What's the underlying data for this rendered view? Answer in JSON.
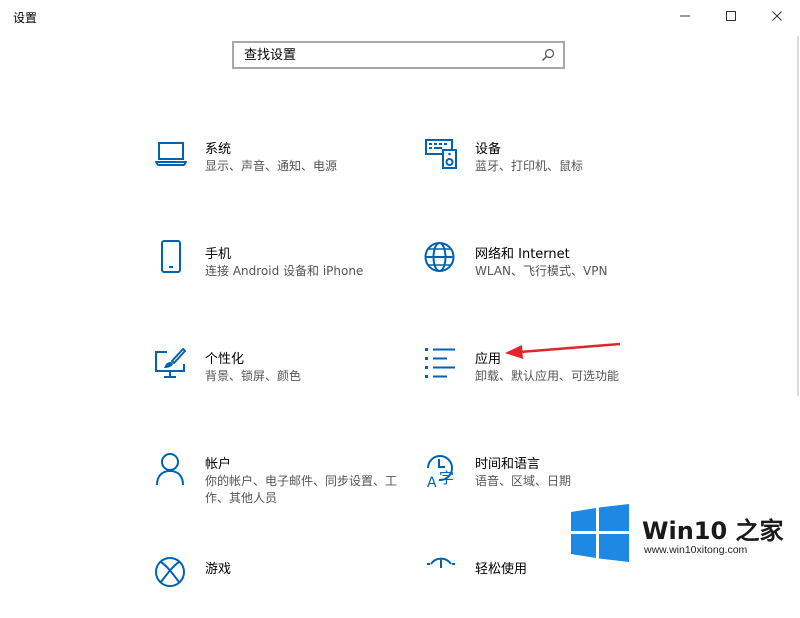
{
  "window": {
    "title": "设置",
    "minimize_glyph": "—",
    "maximize_glyph": "☐",
    "close_glyph": "✕"
  },
  "search": {
    "placeholder": "查找设置",
    "value": ""
  },
  "tiles": [
    {
      "title": "系统",
      "subtitle": "显示、声音、通知、电源",
      "icon": "laptop-icon"
    },
    {
      "title": "设备",
      "subtitle": "蓝牙、打印机、鼠标",
      "icon": "keyboard-speaker-icon"
    },
    {
      "title": "手机",
      "subtitle": "连接 Android 设备和 iPhone",
      "icon": "phone-icon"
    },
    {
      "title": "网络和 Internet",
      "subtitle": "WLAN、飞行模式、VPN",
      "icon": "globe-icon"
    },
    {
      "title": "个性化",
      "subtitle": "背景、锁屏、颜色",
      "icon": "paint-monitor-icon"
    },
    {
      "title": "应用",
      "subtitle": "卸载、默认应用、可选功能",
      "icon": "apps-list-icon"
    },
    {
      "title": "帐户",
      "subtitle": "你的帐户、电子邮件、同步设置、工作、其他人员",
      "icon": "person-icon"
    },
    {
      "title": "时间和语言",
      "subtitle": "语音、区域、日期",
      "icon": "time-language-icon"
    },
    {
      "title": "游戏",
      "subtitle": "",
      "icon": "xbox-icon"
    },
    {
      "title": "轻松使用",
      "subtitle": "",
      "icon": "ease-of-access-icon"
    }
  ],
  "watermark": {
    "brand_prefix": "Win10",
    "brand_suffix": " 之家",
    "url": "www.win10xitong.com"
  },
  "colors": {
    "accent": "#0063b1",
    "arrow": "#e0262b",
    "watermark_blue": "#1e88e5"
  }
}
